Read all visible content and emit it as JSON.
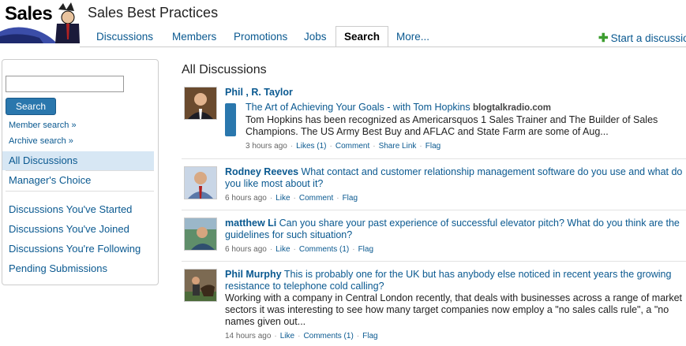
{
  "header": {
    "logo_text": "Sales",
    "group_title": "Sales Best Practices",
    "tabs": [
      {
        "label": "Discussions"
      },
      {
        "label": "Members"
      },
      {
        "label": "Promotions"
      },
      {
        "label": "Jobs"
      },
      {
        "label": "Search"
      },
      {
        "label": "More..."
      }
    ],
    "start_discussion": "Start a discussio"
  },
  "sidebar": {
    "search_value": "",
    "search_button": "Search",
    "member_search": "Member search »",
    "archive_search": "Archive search »",
    "nav": [
      {
        "label": "All Discussions"
      },
      {
        "label": "Manager's Choice"
      },
      {
        "label": "Discussions You've Started"
      },
      {
        "label": "Discussions You've Joined"
      },
      {
        "label": "Discussions You're Following"
      },
      {
        "label": "Pending Submissions"
      }
    ]
  },
  "main": {
    "title": "All Discussions",
    "discussions": [
      {
        "author": "Phil , R. Taylor",
        "share_title": "The Art of Achieving Your Goals - with Tom Hopkins",
        "share_source": "blogtalkradio.com",
        "snippet": "Tom Hopkins has been recognized as Americarsquos 1 Sales Trainer and The Builder of Sales Champions. The US Army Best Buy and AFLAC and State Farm are some of Aug...",
        "time": "3 hours ago",
        "like": "Likes (1)",
        "comment": "Comment",
        "share": "Share Link",
        "flag": "Flag"
      },
      {
        "author": "Rodney Reeves",
        "subject": "What contact and customer relationship management software do you use and what do you like most about it?",
        "time": "6 hours ago",
        "like": "Like",
        "comment": "Comment",
        "flag": "Flag"
      },
      {
        "author": "matthew Li",
        "subject": "Can you share your past experience of successful elevator pitch? What do you think are the guidelines for such situation?",
        "time": "6 hours ago",
        "like": "Like",
        "comment": "Comments (1)",
        "flag": "Flag"
      },
      {
        "author": "Phil Murphy",
        "subject": "This is probably one for the UK but has anybody else noticed in recent years the growing resistance to telephone cold calling?",
        "snippet": "Working with a company in Central London recently, that deals with businesses across a range of market sectors it was interesting to see how many target companies now employ a \"no sales calls rule\", a \"no names given out...",
        "time": "14 hours ago",
        "like": "Like",
        "comment": "Comments (1)",
        "flag": "Flag"
      }
    ]
  },
  "colors": {
    "link": "#0a5990",
    "button": "#2a77ad",
    "nav_active_bg": "#d7e7f4",
    "add_icon": "#3c9d2f"
  }
}
